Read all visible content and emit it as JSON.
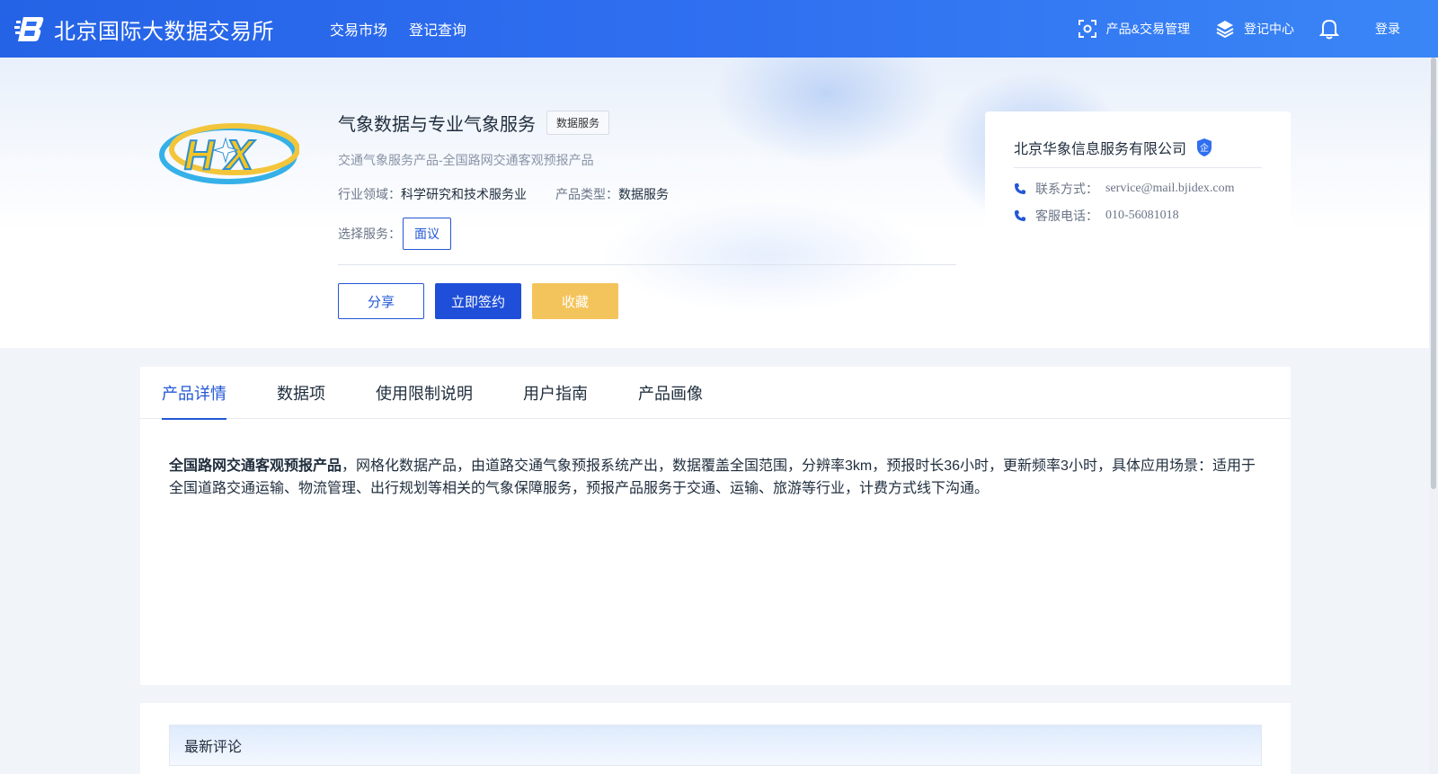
{
  "header": {
    "site_name": "北京国际大数据交易所",
    "nav": [
      "交易市场",
      "登记查询"
    ],
    "product_mgmt": "产品&交易管理",
    "register_center": "登记中心",
    "login": "登录"
  },
  "product": {
    "title": "气象数据与专业气象服务",
    "tag": "数据服务",
    "subtitle": "交通气象服务产品-全国路网交通客观预报产品",
    "industry_label": "行业领域：",
    "industry_value": "科学研究和技术服务业",
    "type_label": "产品类型：",
    "type_value": "数据服务",
    "service_label": "选择服务：",
    "service_option": "面议",
    "share_label": "分享",
    "sign_label": "立即签约",
    "favorite_label": "收藏"
  },
  "company": {
    "name": "北京华象信息服务有限公司",
    "badge": "企",
    "contact_label": "联系方式：",
    "contact_value": "service@mail.bjidex.com",
    "phone_label": "客服电话：",
    "phone_value": "010-56081018"
  },
  "tabs": [
    "产品详情",
    "数据项",
    "使用限制说明",
    "用户指南",
    "产品画像"
  ],
  "detail": {
    "bold": "全国路网交通客观预报产品",
    "text": "，网格化数据产品，由道路交通气象预报系统产出，数据覆盖全国范围，分辨率3km，预报时长36小时，更新频率3小时，具体应用场景：适用于全国道路交通运输、物流管理、出行规划等相关的气象保障服务，预报产品服务于交通、运输、旅游等行业，计费方式线下沟通。"
  },
  "comments": {
    "title": "最新评论"
  },
  "colors": {
    "primary": "#2257d6",
    "header_start": "#2563e6",
    "header_end": "#3a86f6",
    "favorite": "#f4c45c"
  }
}
